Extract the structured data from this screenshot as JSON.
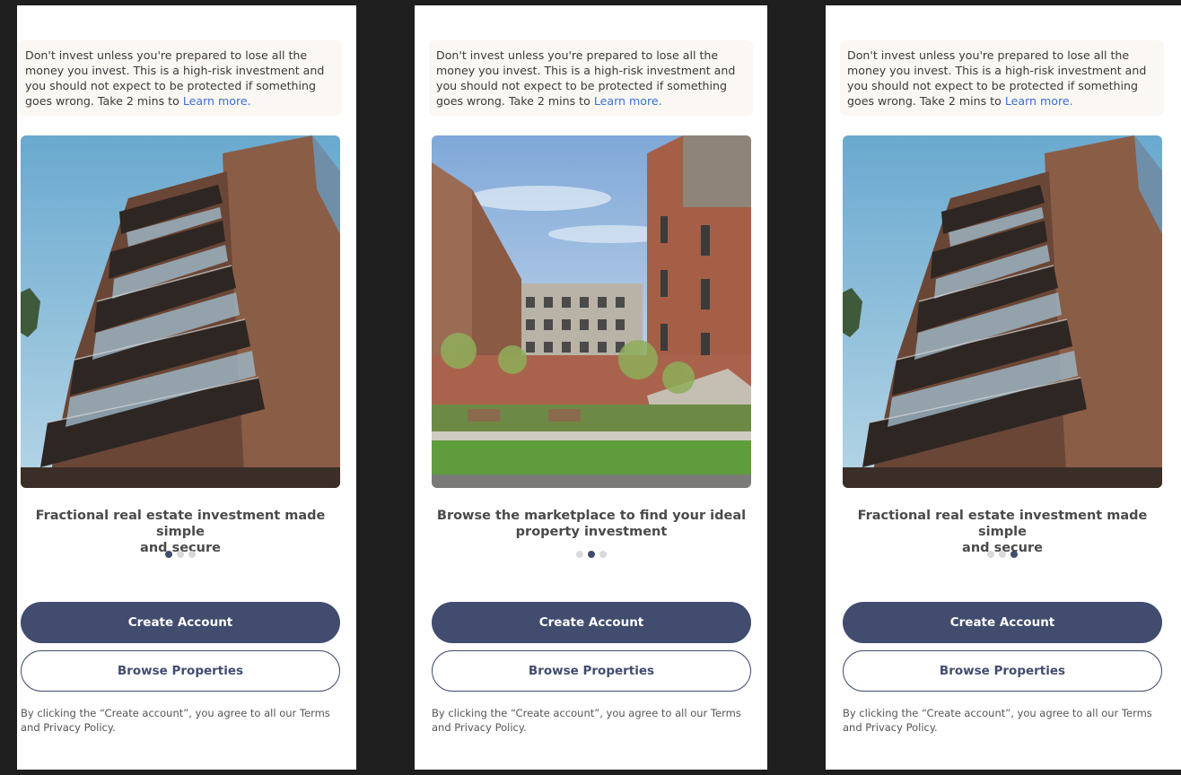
{
  "screens": [
    {
      "risk_warning": "Don't invest unless you're prepared to lose all the money you invest. This is a high-risk investment and you should not expect to be protected if something goes wrong. Take 2 mins to",
      "risk_link": "Learn more.",
      "image": "apartment-tower-image",
      "caption_line1": "Fractional  real estate investment made simple",
      "caption_line2": "and  secure",
      "active_slide": 1,
      "slide_count": 3,
      "primary_button": "Create Account",
      "secondary_button": "Browse Properties",
      "terms": "By clicking the “Create account”, you agree to all our Terms and Privacy Policy."
    },
    {
      "risk_warning": "Don't invest unless you're prepared to lose all the money you invest. This is a high-risk investment and you should not expect to be protected if something goes wrong. Take 2 mins to",
      "risk_link": "Learn more.",
      "image": "courtyard-buildings-image",
      "caption_line1": "Browse the marketplace to find your ideal",
      "caption_line2": "property investment",
      "active_slide": 2,
      "slide_count": 3,
      "primary_button": "Create Account",
      "secondary_button": "Browse Properties",
      "terms": "By clicking the “Create account”, you agree to all our Terms and Privacy Policy."
    },
    {
      "risk_warning": "Don't invest unless you're prepared to lose all the money you invest. This is a high-risk investment and you should not expect to be protected if something goes wrong. Take 2 mins to",
      "risk_link": "Learn more.",
      "image": "apartment-tower-image",
      "caption_line1": "Fractional  real estate investment made simple",
      "caption_line2": "and  secure",
      "active_slide": 3,
      "slide_count": 3,
      "primary_button": "Create Account",
      "secondary_button": "Browse Properties",
      "terms": "By clicking the “Create account”, you agree to all our Terms and Privacy Policy."
    }
  ],
  "colors": {
    "primary": "#414c6e",
    "link": "#3b6fd6",
    "warning_bg": "#fbf8f3",
    "dot_inactive": "#d9d9d9",
    "backdrop": "#1e1e1e"
  }
}
